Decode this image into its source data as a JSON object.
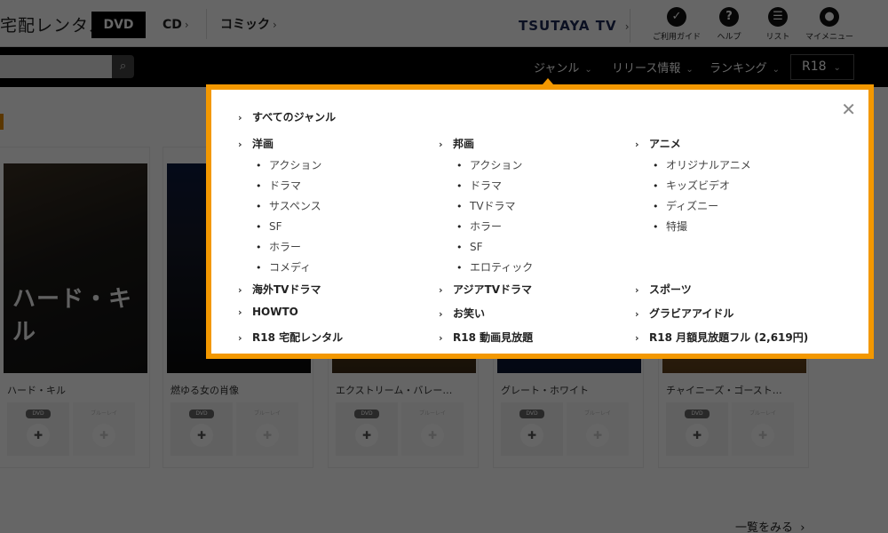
{
  "header": {
    "site_name": "宅配レンタル",
    "category_tabs": [
      {
        "label": "DVD",
        "active": true
      },
      {
        "label": "CD",
        "chevron": "›"
      },
      {
        "label": "コミック",
        "chevron": "›"
      }
    ],
    "tsutaya_tv": {
      "label": "TSUTAYA TV",
      "chevron": "›"
    },
    "utility_links": [
      {
        "label": "ご利用ガイド",
        "icon": "guide-icon",
        "glyph": "✓"
      },
      {
        "label": "ヘルプ",
        "icon": "help-icon",
        "glyph": "?"
      },
      {
        "label": "リスト",
        "icon": "list-icon",
        "glyph": "☰"
      },
      {
        "label": "マイメニュー",
        "icon": "user-icon",
        "glyph": "●"
      }
    ]
  },
  "navbar": {
    "search": {
      "value": "",
      "placeholder": "",
      "button_glyph": "⌕"
    },
    "menu": [
      {
        "label": "ジャンル",
        "chevron": "⌄"
      },
      {
        "label": "リリース情報",
        "chevron": "⌄"
      },
      {
        "label": "ランキング",
        "chevron": "⌄"
      }
    ],
    "r18": {
      "label": "R18",
      "chevron": "⌄"
    }
  },
  "genre_menu": {
    "close_glyph": "✕",
    "arrow_glyph": "›",
    "all_genres": "すべてのジャンル",
    "columns": [
      {
        "title": "洋画",
        "items": [
          "アクション",
          "ドラマ",
          "サスペンス",
          "SF",
          "ホラー",
          "コメディ"
        ]
      },
      {
        "title": "邦画",
        "items": [
          "アクション",
          "ドラマ",
          "TVドラマ",
          "ホラー",
          "SF",
          "エロティック"
        ]
      },
      {
        "title": "アニメ",
        "items": [
          "オリジナルアニメ",
          "キッズビデオ",
          "ディズニー",
          "特撮"
        ]
      }
    ],
    "bottom_links": [
      [
        "海外TVドラマ",
        "アジアTVドラマ",
        "スポーツ"
      ],
      [
        "HOWTO",
        "お笑い",
        "グラビアアイドル"
      ],
      [
        "R18 宅配レンタル",
        "R18 動画見放題",
        "R18 月額見放題フル (2,619円)"
      ]
    ]
  },
  "products": [
    {
      "title": "ハード・キル",
      "cover_text": "ハード・キル",
      "formats": [
        "DVD",
        "ブルーレイ"
      ]
    },
    {
      "title": "燃ゆる女の肖像",
      "cover_text": "",
      "formats": [
        "DVD",
        "ブルーレイ"
      ]
    },
    {
      "title": "エクストリーム・バレー…",
      "cover_text": "",
      "formats": [
        "DVD",
        "ブルーレイ"
      ]
    },
    {
      "title": "グレート・ホワイト",
      "cover_text": "",
      "formats": [
        "DVD",
        "ブルーレイ"
      ]
    },
    {
      "title": "チャイニーズ・ゴースト…",
      "cover_text": "",
      "formats": [
        "DVD",
        "ブルーレイ"
      ]
    }
  ],
  "see_all": {
    "label": "一覧をみる",
    "chevron": "›"
  },
  "colors": {
    "accent": "#f39800",
    "overlay": "rgba(0,0,0,0.6)"
  }
}
